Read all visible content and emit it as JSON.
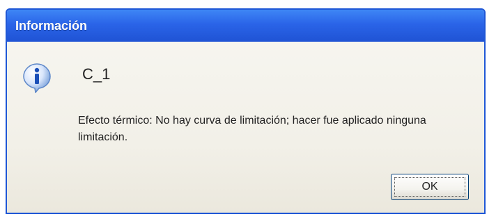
{
  "window": {
    "title": "Información",
    "accent_color": "#2a64e8"
  },
  "dialog": {
    "icon": "info-icon",
    "header": "C_1",
    "message": "Efecto térmico: No hay curva de limitación; hacer fue aplicado ninguna limitación.",
    "ok_label": "OK"
  }
}
